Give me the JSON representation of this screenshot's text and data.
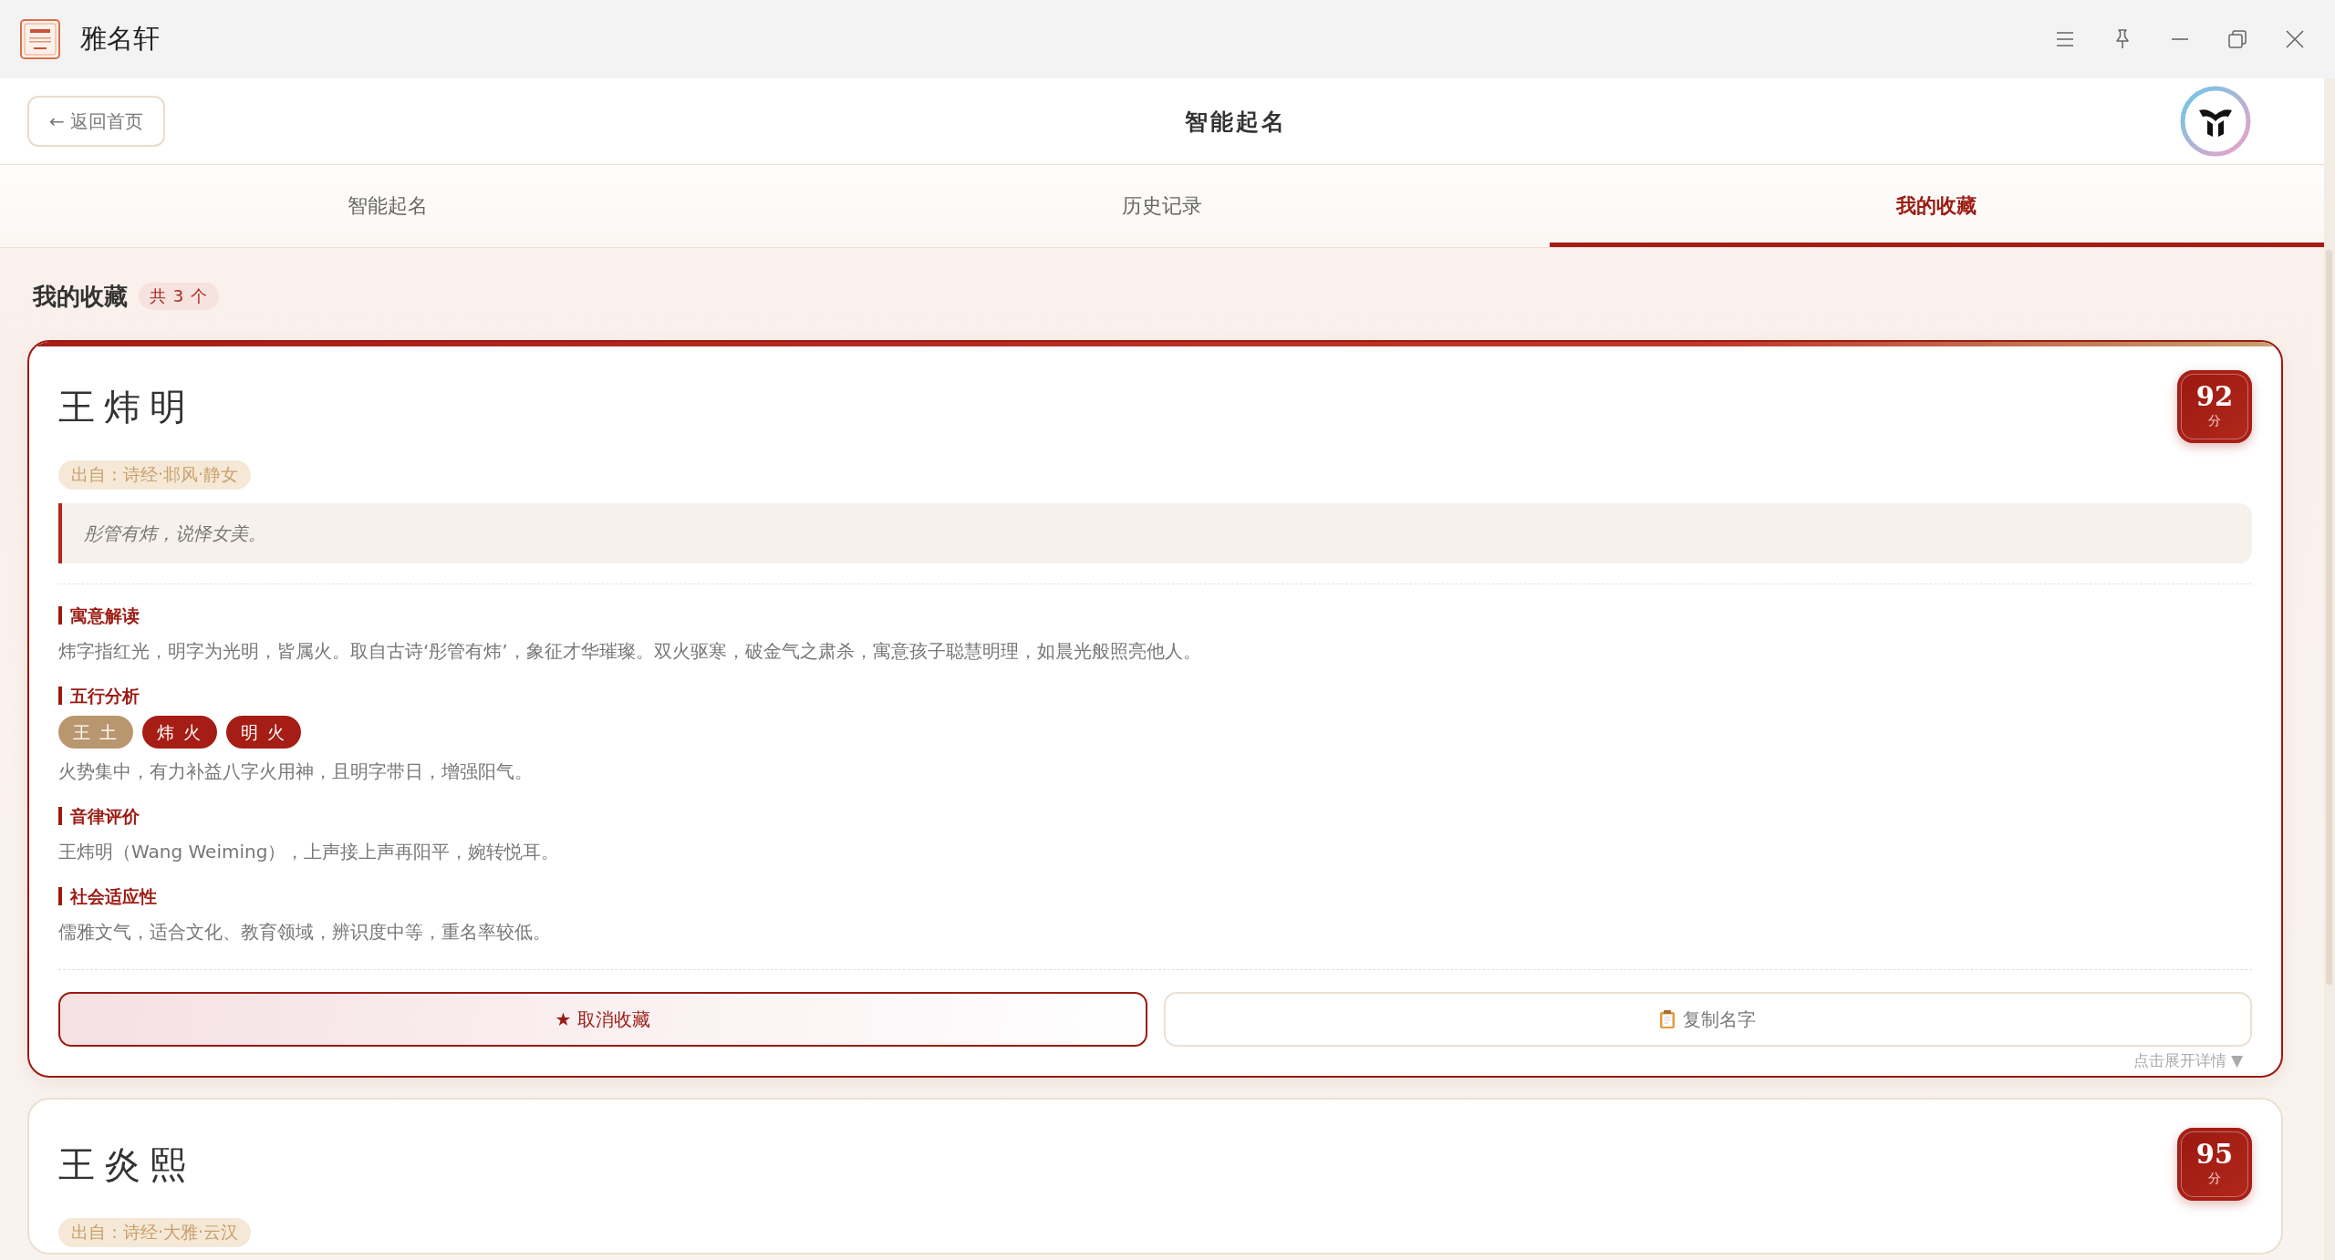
{
  "app": {
    "title": "雅名轩"
  },
  "header": {
    "back_button": "← 返回首页",
    "title": "智能起名"
  },
  "tabs": [
    {
      "label": "智能起名",
      "selected": false
    },
    {
      "label": "历史记录",
      "selected": false
    },
    {
      "label": "我的收藏",
      "selected": true
    }
  ],
  "favorites": {
    "heading": "我的收藏",
    "count": "共 3 个",
    "cards": [
      {
        "name": "王炜明",
        "score": "92",
        "score_unit": "分",
        "selected": true,
        "source": "出自：诗经·邶风·静女",
        "quote": "彤管有炜，说怿女美。",
        "sections": [
          {
            "kind": "text",
            "title": "寓意解读",
            "text": "炜字指红光，明字为光明，皆属火。取自古诗‘彤管有炜’，象征才华璀璨。双火驱寒，破金气之肃杀，寓意孩子聪慧明理，如晨光般照亮他人。"
          },
          {
            "kind": "elements",
            "title": "五行分析",
            "tags": [
              {
                "label": "王 土",
                "color": "#b8966e"
              },
              {
                "label": "炜 火",
                "color": "#a51d15"
              },
              {
                "label": "明 火",
                "color": "#a51d15"
              }
            ],
            "text": "火势集中，有力补益八字火用神，且明字带日，增强阳气。"
          },
          {
            "kind": "text",
            "title": "音律评价",
            "text": "王炜明（Wang Weiming），上声接上声再阳平，婉转悦耳。"
          },
          {
            "kind": "text",
            "title": "社会适应性",
            "text": "儒雅文气，适合文化、教育领域，辨识度中等，重名率较低。"
          }
        ],
        "actions": [
          {
            "kind": "unfavorite",
            "label": "★ 取消收藏"
          },
          {
            "kind": "copy",
            "label": "复制名字"
          }
        ],
        "toggle": "点击展开详情 ▼"
      },
      {
        "name": "王炎熙",
        "score": "95",
        "score_unit": "分",
        "selected": false,
        "source": "出自：诗经·大雅·云汉"
      }
    ]
  }
}
